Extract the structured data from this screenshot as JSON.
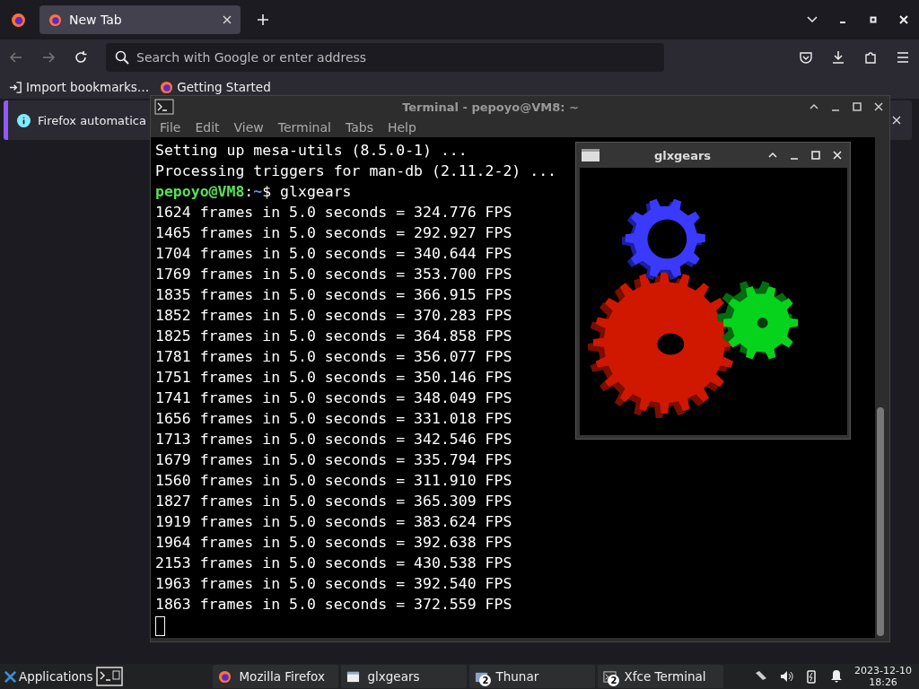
{
  "firefox": {
    "tabs": [
      {
        "label": "New Tab",
        "selected": true
      }
    ],
    "address": {
      "placeholder": "Search with Google or enter address"
    },
    "bookmarks": [
      "Import bookmarks…",
      "Getting Started"
    ],
    "notification": {
      "text": "Firefox automatica"
    }
  },
  "terminal": {
    "title": "Terminal - pepoyo@VM8: ~",
    "menu": [
      "File",
      "Edit",
      "View",
      "Terminal",
      "Tabs",
      "Help"
    ],
    "lines": [
      {
        "kind": "text",
        "text": "Setting up mesa-utils (8.5.0-1) ..."
      },
      {
        "kind": "text",
        "text": "Processing triggers for man-db (2.11.2-2) ..."
      },
      {
        "kind": "prompt",
        "user_host": "pepoyo@VM8",
        "sep": ":",
        "path": "~",
        "command": "$ glxgears"
      },
      {
        "kind": "text",
        "text": "1624 frames in 5.0 seconds = 324.776 FPS"
      },
      {
        "kind": "text",
        "text": "1465 frames in 5.0 seconds = 292.927 FPS"
      },
      {
        "kind": "text",
        "text": "1704 frames in 5.0 seconds = 340.644 FPS"
      },
      {
        "kind": "text",
        "text": "1769 frames in 5.0 seconds = 353.700 FPS"
      },
      {
        "kind": "text",
        "text": "1835 frames in 5.0 seconds = 366.915 FPS"
      },
      {
        "kind": "text",
        "text": "1852 frames in 5.0 seconds = 370.283 FPS"
      },
      {
        "kind": "text",
        "text": "1825 frames in 5.0 seconds = 364.858 FPS"
      },
      {
        "kind": "text",
        "text": "1781 frames in 5.0 seconds = 356.077 FPS"
      },
      {
        "kind": "text",
        "text": "1751 frames in 5.0 seconds = 350.146 FPS"
      },
      {
        "kind": "text",
        "text": "1741 frames in 5.0 seconds = 348.049 FPS"
      },
      {
        "kind": "text",
        "text": "1656 frames in 5.0 seconds = 331.018 FPS"
      },
      {
        "kind": "text",
        "text": "1713 frames in 5.0 seconds = 342.546 FPS"
      },
      {
        "kind": "text",
        "text": "1679 frames in 5.0 seconds = 335.794 FPS"
      },
      {
        "kind": "text",
        "text": "1560 frames in 5.0 seconds = 311.910 FPS"
      },
      {
        "kind": "text",
        "text": "1827 frames in 5.0 seconds = 365.309 FPS"
      },
      {
        "kind": "text",
        "text": "1919 frames in 5.0 seconds = 383.624 FPS"
      },
      {
        "kind": "text",
        "text": "1964 frames in 5.0 seconds = 392.638 FPS"
      },
      {
        "kind": "text",
        "text": "2153 frames in 5.0 seconds = 430.538 FPS"
      },
      {
        "kind": "text",
        "text": "1963 frames in 5.0 seconds = 392.540 FPS"
      },
      {
        "kind": "text",
        "text": "1863 frames in 5.0 seconds = 372.559 FPS"
      },
      {
        "kind": "cursor"
      }
    ]
  },
  "glxgears": {
    "title": "glxgears"
  },
  "taskbar": {
    "start": "Applications",
    "tasks": [
      {
        "label": "Mozilla Firefox",
        "kind": "firefox"
      },
      {
        "label": "glxgears",
        "kind": "window"
      },
      {
        "label": "Thunar",
        "kind": "files",
        "badge": "2"
      },
      {
        "label": "Xfce Terminal",
        "kind": "terminal",
        "badge": "2"
      }
    ],
    "clock": {
      "date": "2023-12-10",
      "time": "18:26"
    }
  }
}
